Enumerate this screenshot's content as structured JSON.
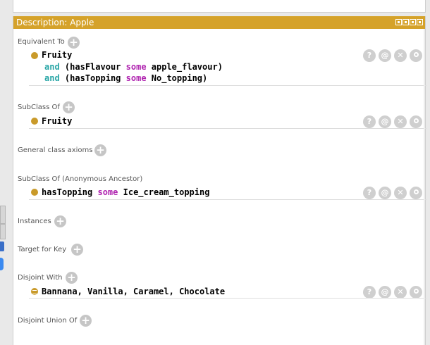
{
  "panel": {
    "title": "Description: Apple",
    "colors": {
      "titlebar": "#d5a22a",
      "keyword_and": "#2aa7a7",
      "keyword_some": "#b024b0",
      "bullet": "#c99a2a"
    }
  },
  "sections": {
    "equivalent_to": {
      "label": "Equivalent To",
      "axiom": {
        "line1": "Fruity",
        "line2_and": "and",
        "line2_rest_a": "(hasFlavour",
        "line2_some": "some",
        "line2_rest_b": "apple_flavour)",
        "line3_and": "and",
        "line3_rest_a": "(hasTopping",
        "line3_some": "some",
        "line3_rest_b": "No_topping)"
      }
    },
    "subclass_of": {
      "label": "SubClass Of",
      "axiom": "Fruity"
    },
    "general_class_axioms": {
      "label": "General class axioms"
    },
    "subclass_anon": {
      "label": "SubClass Of (Anonymous Ancestor)",
      "axiom_a": "hasTopping",
      "axiom_some": "some",
      "axiom_b": "Ice_cream_topping"
    },
    "instances": {
      "label": "Instances"
    },
    "target_for_key": {
      "label": "Target for Key"
    },
    "disjoint_with": {
      "label": "Disjoint With",
      "axiom": "Bannana, Vanilla, Caramel, Chocolate"
    },
    "disjoint_union_of": {
      "label": "Disjoint Union Of"
    }
  },
  "actions": {
    "help": "?",
    "annotate": "@",
    "delete": "✕"
  },
  "icons": {
    "add": "plus-icon",
    "help": "help-icon",
    "annotate": "at-icon",
    "delete": "close-icon",
    "edit": "circle-icon",
    "bullet": "class-bullet-icon",
    "disjoint_bullet": "disjoint-bullet-icon"
  }
}
